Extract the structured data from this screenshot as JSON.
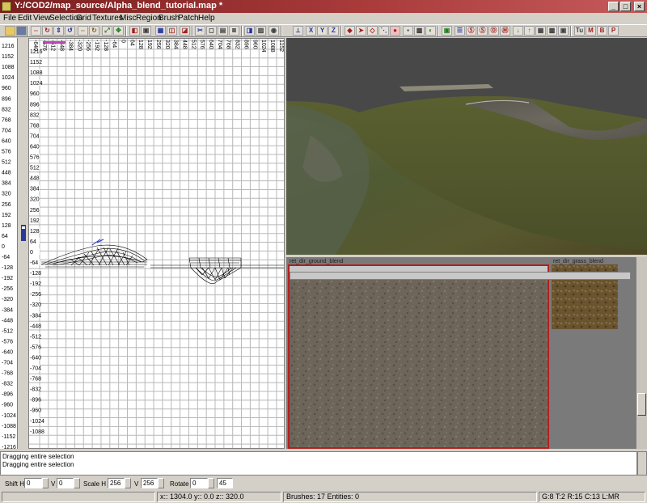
{
  "window": {
    "title": "Y:/COD2/map_source/Alpha_blend_tutorial.map *",
    "minimize_glyph": "_",
    "maximize_glyph": "□",
    "close_glyph": "×"
  },
  "menu": [
    "File",
    "Edit",
    "View",
    "Selection",
    "Grid",
    "Textures",
    "Misc",
    "Region",
    "Brush",
    "Patch",
    "Help"
  ],
  "toolbar": {
    "x_label": "X",
    "y_label": "Y",
    "z_label": "Z",
    "tu_label": "Tu",
    "m_label": "M",
    "b_label": "B",
    "p_label": "P"
  },
  "grid_view": {
    "z_ruler_labels": [
      "1216",
      "1152",
      "1088",
      "1024",
      "960",
      "896",
      "832",
      "768",
      "704",
      "640",
      "576",
      "512",
      "448",
      "384",
      "320",
      "256",
      "192",
      "128",
      "64",
      "0",
      "-64",
      "-128",
      "-192",
      "-256",
      "-320",
      "-384",
      "-448",
      "-512",
      "-576",
      "-640",
      "-704",
      "-768",
      "-832",
      "-896",
      "-960",
      "-1024",
      "-1088",
      "-1152",
      "-1216"
    ],
    "y_labels": [
      "1216",
      "1152",
      "1088",
      "1024",
      "960",
      "896",
      "832",
      "768",
      "704",
      "640",
      "576",
      "512",
      "448",
      "384",
      "320",
      "256",
      "192",
      "128",
      "64",
      "0",
      "-64",
      "-128",
      "-192",
      "-256",
      "-320",
      "-384",
      "-448",
      "-512",
      "-576",
      "-640",
      "-704",
      "-768",
      "-832",
      "-896",
      "-960",
      "-1024",
      "-1088"
    ],
    "x_labels": [
      "-640",
      "-576",
      "-512",
      "-448",
      "-384",
      "-320",
      "-256",
      "-192",
      "-128",
      "-64",
      "0",
      "64",
      "128",
      "192",
      "256",
      "320",
      "384",
      "448",
      "512",
      "576",
      "640",
      "704",
      "768",
      "832",
      "896",
      "960",
      "1024",
      "1088",
      "1152",
      "1216",
      "1280"
    ]
  },
  "texture_browser": {
    "textures": [
      {
        "name": "ret_dir_ground_blend",
        "selected": true
      },
      {
        "name": "ret_dir_grass_blend",
        "selected": false
      }
    ]
  },
  "console": {
    "lines": [
      "Dragging entire selection",
      "Dragging entire selection"
    ]
  },
  "surface_inspector": {
    "shift_h_label": "Shift H",
    "shift_h_value": "0",
    "shift_v_label": "V",
    "shift_v_value": "0",
    "scale_h_label": "Scale H",
    "scale_h_value": "256",
    "scale_v_label": "V",
    "scale_v_value": "256",
    "rotate_label": "Rotate",
    "rotate_value": "0",
    "rotate_step_value": "45"
  },
  "status": {
    "coords": "x:: 1304.0  y:: 0.0  z:: 320.0",
    "brushes": "Brushes: 17 Entities: 0",
    "grid": "G:8 T:2 R:15 C:13 L:MR"
  },
  "colors": {
    "titlebar_start": "#7a1f1f",
    "titlebar_end": "#c65a5a",
    "chrome": "#d4d0c8",
    "selected_texture_border": "#b02020"
  }
}
